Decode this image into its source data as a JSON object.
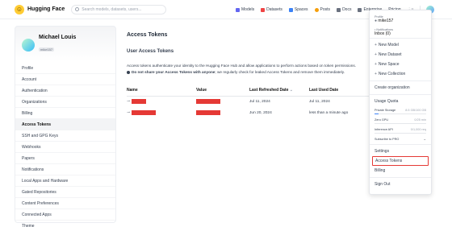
{
  "topbar": {
    "brand": "Hugging Face",
    "search_placeholder": "Search models, datasets, users...",
    "nav": [
      {
        "label": "Models",
        "icon": "models-icon",
        "color": "#6366f1"
      },
      {
        "label": "Datasets",
        "icon": "datasets-icon",
        "color": "#ef4444"
      },
      {
        "label": "Spaces",
        "icon": "spaces-icon",
        "color": "#3b82f6"
      },
      {
        "label": "Posts",
        "icon": "posts-icon",
        "color": "#f59e0b"
      },
      {
        "label": "Docs",
        "icon": "docs-icon",
        "color": "#6b7280"
      },
      {
        "label": "Enterprise",
        "icon": "enterprise-icon",
        "color": "#6b7280"
      },
      {
        "label": "Pricing",
        "icon": "",
        "color": ""
      }
    ]
  },
  "sidebar": {
    "name": "Michael Louis",
    "handle": "mike157",
    "items": [
      {
        "label": "Profile"
      },
      {
        "label": "Account"
      },
      {
        "label": "Authentication"
      },
      {
        "label": "Organizations"
      },
      {
        "label": "Billing"
      },
      {
        "label": "Access Tokens",
        "active": true
      },
      {
        "label": "SSH and GPG Keys"
      },
      {
        "label": "Webhooks"
      },
      {
        "label": "Papers"
      },
      {
        "label": "Notifications"
      },
      {
        "label": "Local Apps and Hardware"
      },
      {
        "label": "Gated Repositories"
      },
      {
        "label": "Content Preferences"
      },
      {
        "label": "Connected Apps"
      },
      {
        "label": "Theme"
      }
    ]
  },
  "main": {
    "title": "Access Tokens",
    "section_title": "User Access Tokens",
    "description": "Access tokens authenticate your identity to the Hugging Face Hub and allow applications to perform actions based on token permissions.",
    "warning_bold": "Do not share your Access Tokens with anyone",
    "warning_rest": "; we regularly check for leaked Access Tokens and remove them immediately.",
    "columns": [
      "Name",
      "Value",
      "Last Refreshed Date",
      "Last Used Date"
    ],
    "rows": [
      {
        "refreshed": "Jul 11, 2024",
        "used": "Jul 11, 2024"
      },
      {
        "refreshed": "Jun 20, 2024",
        "used": "less than a minute ago"
      }
    ]
  },
  "dropdown": {
    "profile_label": "Profile",
    "profile_value": "mike157",
    "notifications_label": "Notifications",
    "notifications_value": "Inbox (0)",
    "new_items": [
      "New Model",
      "New Dataset",
      "New Space",
      "New Collection"
    ],
    "create_org": "Create organization",
    "usage_quota": "Usage Quota",
    "quotas": [
      {
        "label": "Private Storage",
        "value": "8.5 GB/100 GB",
        "fraction": 0.085
      },
      {
        "label": "Zero GPU",
        "value": "0/25 min",
        "fraction": 0
      },
      {
        "label": "Inference API",
        "value": "0/1,000 req",
        "fraction": 0
      }
    ],
    "subscribe": "Subscribe to PRO",
    "settings": "Settings",
    "access_tokens": "Access Tokens",
    "billing": "Billing",
    "sign_out": "Sign Out"
  }
}
